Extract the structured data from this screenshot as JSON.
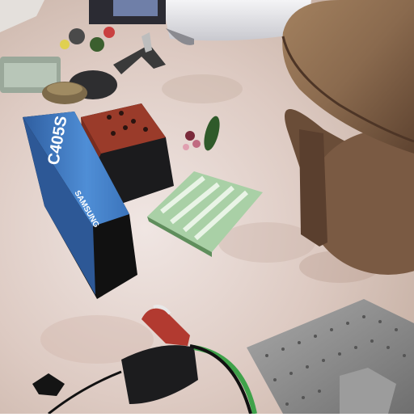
{
  "scene": {
    "description_visible_text": {
      "box_model": "C405S",
      "box_brand": "SAMSUNG"
    },
    "colors": {
      "floor": "#d9c6bd",
      "table_wood": "#8a6a4e",
      "box_blue": "#3f7fc6",
      "brick": "#9a3b2a",
      "towel_green": "#8fbf8f",
      "plate": "#8c8c8c"
    }
  }
}
